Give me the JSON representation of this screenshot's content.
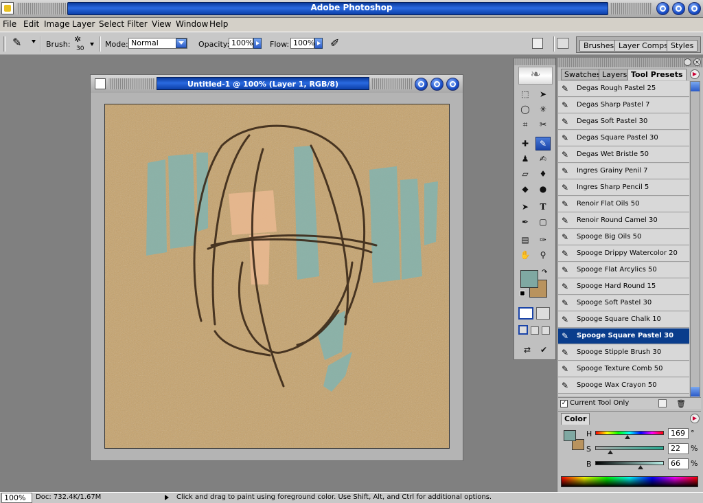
{
  "app": {
    "title": "Adobe Photoshop"
  },
  "menu": [
    "File",
    "Edit",
    "Image",
    "Layer",
    "Select",
    "Filter",
    "View",
    "Window",
    "Help"
  ],
  "options": {
    "brush_label": "Brush:",
    "brush_size": "30",
    "mode_label": "Mode:",
    "mode_value": "Normal",
    "opacity_label": "Opacity:",
    "opacity_value": "100%",
    "flow_label": "Flow:",
    "flow_value": "100%"
  },
  "well_tabs": [
    "Brushes",
    "Layer Comps",
    "Styles"
  ],
  "document": {
    "title": "Untitled-1 @ 100% (Layer 1, RGB/8)"
  },
  "panel_tabs": [
    "Swatches",
    "Layers",
    "Tool Presets"
  ],
  "presets": [
    "Degas Rough Pastel 25",
    "Degas Sharp Pastel 7",
    "Degas Soft Pastel 30",
    "Degas Square Pastel 30",
    "Degas Wet Bristle 50",
    "Ingres Grainy Penil 7",
    "Ingres Sharp Pencil 5",
    "Renoir Flat Oils 50",
    "Renoir Round Camel 30",
    "Spooge Big Oils 50",
    "Spooge Drippy Watercolor 20",
    "Spooge Flat Arcylics 50",
    "Spooge Hard Round 15",
    "Spooge Soft Pastel 30",
    "Spooge Square Chalk 10",
    "Spooge Square Pastel 30",
    "Spooge Stipple Brush 30",
    "Spooge Texture Comb 50",
    "Spooge Wax Crayon 50"
  ],
  "selected_preset": "Spooge Square Pastel 30",
  "current_tool_only": "Current Tool Only",
  "color_panel": {
    "tab": "Color",
    "h_label": "H",
    "h_value": "169",
    "h_unit": "°",
    "s_label": "S",
    "s_value": "22",
    "s_unit": "%",
    "b_label": "B",
    "b_value": "66",
    "b_unit": "%"
  },
  "colors": {
    "foreground": "#7fa8a2",
    "background": "#b9935e"
  },
  "status": {
    "zoom": "100%",
    "doc": "Doc: 732.4K/1.67M",
    "message": "Click and drag to paint using foreground color.  Use Shift, Alt, and Ctrl for additional options."
  }
}
